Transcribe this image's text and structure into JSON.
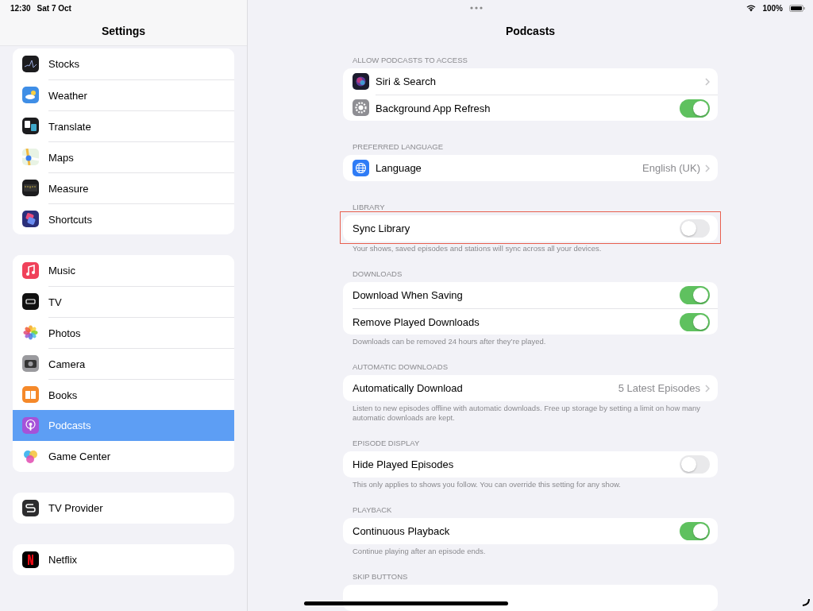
{
  "status_bar": {
    "time": "12:30",
    "date": "Sat 7 Oct",
    "battery": "100%"
  },
  "sidebar": {
    "title": "Settings",
    "groups": [
      {
        "items": [
          {
            "label": "Stocks",
            "selected": false
          },
          {
            "label": "Weather",
            "selected": false
          },
          {
            "label": "Translate",
            "selected": false
          },
          {
            "label": "Maps",
            "selected": false
          },
          {
            "label": "Measure",
            "selected": false
          },
          {
            "label": "Shortcuts",
            "selected": false
          }
        ]
      },
      {
        "items": [
          {
            "label": "Music",
            "selected": false
          },
          {
            "label": "TV",
            "selected": false
          },
          {
            "label": "Photos",
            "selected": false
          },
          {
            "label": "Camera",
            "selected": false
          },
          {
            "label": "Books",
            "selected": false
          },
          {
            "label": "Podcasts",
            "selected": true
          },
          {
            "label": "Game Center",
            "selected": false
          }
        ]
      },
      {
        "items": [
          {
            "label": "TV Provider",
            "selected": false
          }
        ]
      },
      {
        "items": [
          {
            "label": "Netflix",
            "selected": false
          }
        ]
      }
    ]
  },
  "detail": {
    "title": "Podcasts",
    "sections": [
      {
        "header": "ALLOW PODCASTS TO ACCESS",
        "highlighted": false,
        "rows": [
          {
            "kind": "link",
            "label": "Siri & Search"
          },
          {
            "kind": "toggle",
            "label": "Background App Refresh",
            "on": true
          }
        ]
      },
      {
        "header": "PREFERRED LANGUAGE",
        "highlighted": false,
        "rows": [
          {
            "kind": "link",
            "label": "Language",
            "value": "English (UK)"
          }
        ]
      },
      {
        "header": "LIBRARY",
        "highlighted": true,
        "rows": [
          {
            "kind": "toggle",
            "label": "Sync Library",
            "on": false
          }
        ],
        "footer": "Your shows, saved episodes and stations will sync across all your devices."
      },
      {
        "header": "DOWNLOADS",
        "highlighted": false,
        "rows": [
          {
            "kind": "toggle",
            "label": "Download When Saving",
            "on": true
          },
          {
            "kind": "toggle",
            "label": "Remove Played Downloads",
            "on": true
          }
        ],
        "footer": "Downloads can be removed 24 hours after they’re played."
      },
      {
        "header": "AUTOMATIC DOWNLOADS",
        "highlighted": false,
        "rows": [
          {
            "kind": "link",
            "label": "Automatically Download",
            "value": "5 Latest Episodes"
          }
        ],
        "footer": "Listen to new episodes offline with automatic downloads. Free up storage by setting a limit on how many automatic downloads are kept."
      },
      {
        "header": "EPISODE DISPLAY",
        "highlighted": false,
        "rows": [
          {
            "kind": "toggle",
            "label": "Hide Played Episodes",
            "on": false
          }
        ],
        "footer": "This only applies to shows you follow. You can override this setting for any show."
      },
      {
        "header": "PLAYBACK",
        "highlighted": false,
        "rows": [
          {
            "kind": "toggle",
            "label": "Continuous Playback",
            "on": true
          }
        ],
        "footer": "Continue playing after an episode ends."
      },
      {
        "header": "SKIP BUTTONS",
        "highlighted": false
      }
    ]
  }
}
